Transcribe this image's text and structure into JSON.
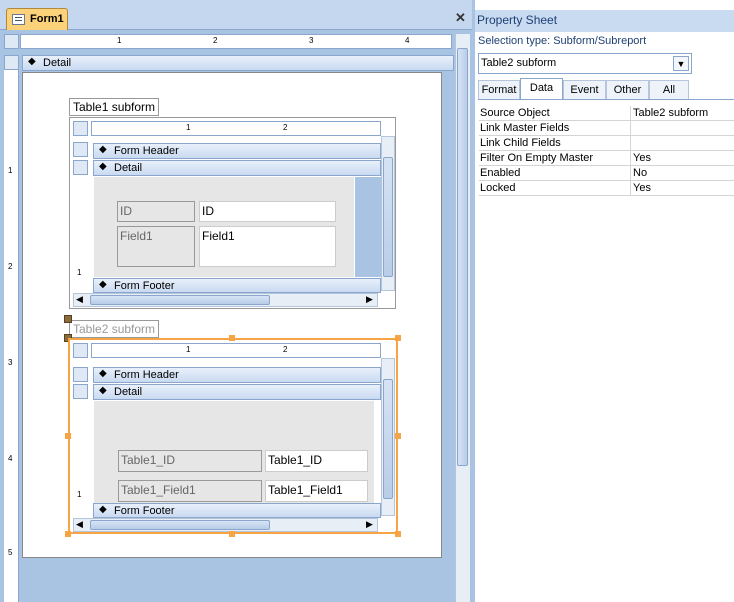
{
  "document_tab": {
    "label": "Form1"
  },
  "ruler_ticks": [
    "1",
    "2",
    "3",
    "4"
  ],
  "vruler_ticks": [
    "1",
    "2",
    "3",
    "4",
    "5"
  ],
  "sections": {
    "detail": "Detail"
  },
  "subform1": {
    "label": "Table1 subform",
    "ruler_ticks": [
      "1",
      "2"
    ],
    "bands": {
      "header": "Form Header",
      "detail": "Detail",
      "footer": "Form Footer"
    },
    "fields": [
      {
        "label": "ID",
        "value": "ID"
      },
      {
        "label": "Field1",
        "value": "Field1"
      }
    ]
  },
  "subform2": {
    "label": "Table2 subform",
    "ruler_ticks": [
      "1",
      "2"
    ],
    "bands": {
      "header": "Form Header",
      "detail": "Detail",
      "footer": "Form Footer"
    },
    "fields": [
      {
        "label": "Table1_ID",
        "value": "Table1_ID"
      },
      {
        "label": "Table1_Field1",
        "value": "Table1_Field1"
      }
    ]
  },
  "property_sheet": {
    "title": "Property Sheet",
    "selection_type": "Selection type:  Subform/Subreport",
    "selected_object": "Table2 subform",
    "tabs": [
      "Format",
      "Data",
      "Event",
      "Other",
      "All"
    ],
    "active_tab": "Data",
    "properties": [
      {
        "name": "Source Object",
        "value": "Table2 subform"
      },
      {
        "name": "Link Master Fields",
        "value": ""
      },
      {
        "name": "Link Child Fields",
        "value": ""
      },
      {
        "name": "Filter On Empty Master",
        "value": "Yes"
      },
      {
        "name": "Enabled",
        "value": "No"
      },
      {
        "name": "Locked",
        "value": "Yes"
      }
    ]
  },
  "colors": {
    "accent": "#f7a444",
    "chrome": "#a9c3e3",
    "band": "#c9daf1",
    "title_text": "#1d3f74"
  }
}
